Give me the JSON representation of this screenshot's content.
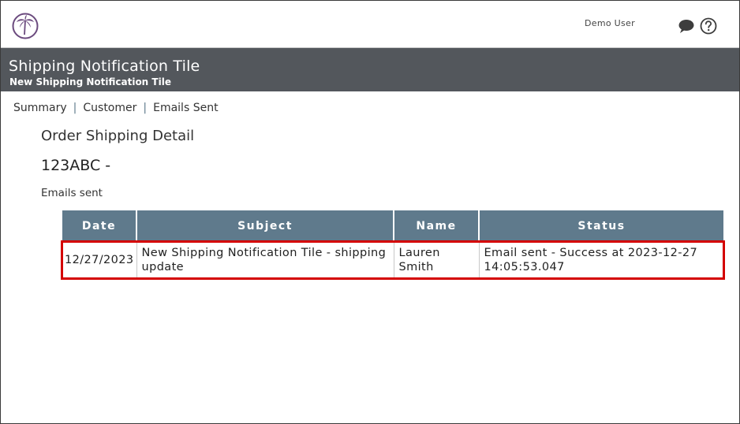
{
  "header": {
    "logo_icon": "palm-tree-logo-icon",
    "user_name": "Demo User",
    "chat_icon": "chat-bubble-icon",
    "help_icon": "help-circle-icon"
  },
  "title_band": {
    "title": "Shipping Notification Tile",
    "subtitle": "New Shipping Notification Tile"
  },
  "tabs": [
    {
      "label": "Summary"
    },
    {
      "label": "Customer"
    },
    {
      "label": "Emails Sent"
    }
  ],
  "tab_separator": "|",
  "detail": {
    "section_title": "Order Shipping Detail",
    "order_id": "123ABC -",
    "emails_label": "Emails sent"
  },
  "table": {
    "columns": [
      "Date",
      "Subject",
      "Name",
      "Status"
    ],
    "rows": [
      {
        "date": "12/27/2023",
        "subject": "New Shipping Notification Tile - shipping update",
        "name": "Lauren Smith",
        "status": "Email sent - Success at 2023-12-27 14:05:53.047"
      }
    ]
  },
  "colors": {
    "title_band": "#53575c",
    "table_header": "#5f7a8c",
    "highlight": "#d40000",
    "logo": "#6b4a7e"
  }
}
